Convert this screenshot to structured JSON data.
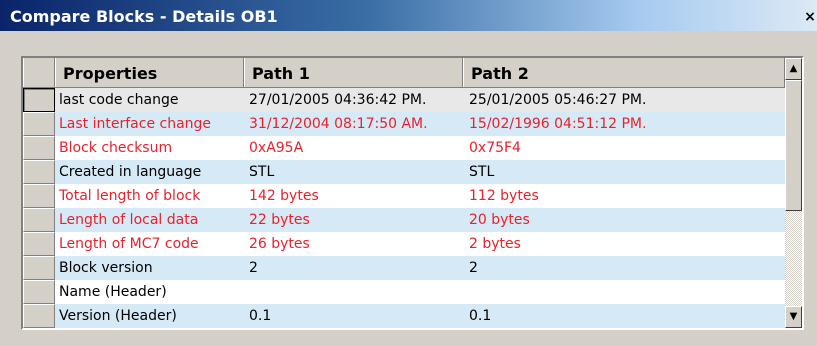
{
  "window": {
    "title": "Compare Blocks - Details OB1",
    "close_glyph": "×"
  },
  "table": {
    "columns": [
      "Properties",
      "Path 1",
      "Path 2"
    ],
    "rows": [
      {
        "property": "last code change",
        "path1": "27/01/2005  04:36:42 PM.",
        "path2": "25/01/2005  05:46:27 PM.",
        "differs": false
      },
      {
        "property": "Last interface change",
        "path1": "31/12/2004  08:17:50 AM.",
        "path2": "15/02/1996  04:51:12 PM.",
        "differs": true
      },
      {
        "property": "Block checksum",
        "path1": "0xA95A",
        "path2": "0x75F4",
        "differs": true
      },
      {
        "property": "Created in language",
        "path1": "STL",
        "path2": "STL",
        "differs": false
      },
      {
        "property": "Total length of block",
        "path1": "142 bytes",
        "path2": "112 bytes",
        "differs": true
      },
      {
        "property": "Length of local data",
        "path1": "22 bytes",
        "path2": "20 bytes",
        "differs": true
      },
      {
        "property": "Length of MC7 code",
        "path1": "26 bytes",
        "path2": "2 bytes",
        "differs": true
      },
      {
        "property": "Block version",
        "path1": " 2",
        "path2": " 2",
        "differs": false
      },
      {
        "property": "Name (Header)",
        "path1": "",
        "path2": "",
        "differs": false
      },
      {
        "property": "Version (Header)",
        "path1": "0.1",
        "path2": "0.1",
        "differs": false
      }
    ]
  },
  "scrollbar": {
    "up_glyph": "▲",
    "down_glyph": "▼",
    "position_fraction": 0.0
  },
  "colors": {
    "difference_text": "#e8212b",
    "normal_text": "#000000",
    "alt_row": "#d6e9f6",
    "title_bar": "#0a246a"
  }
}
